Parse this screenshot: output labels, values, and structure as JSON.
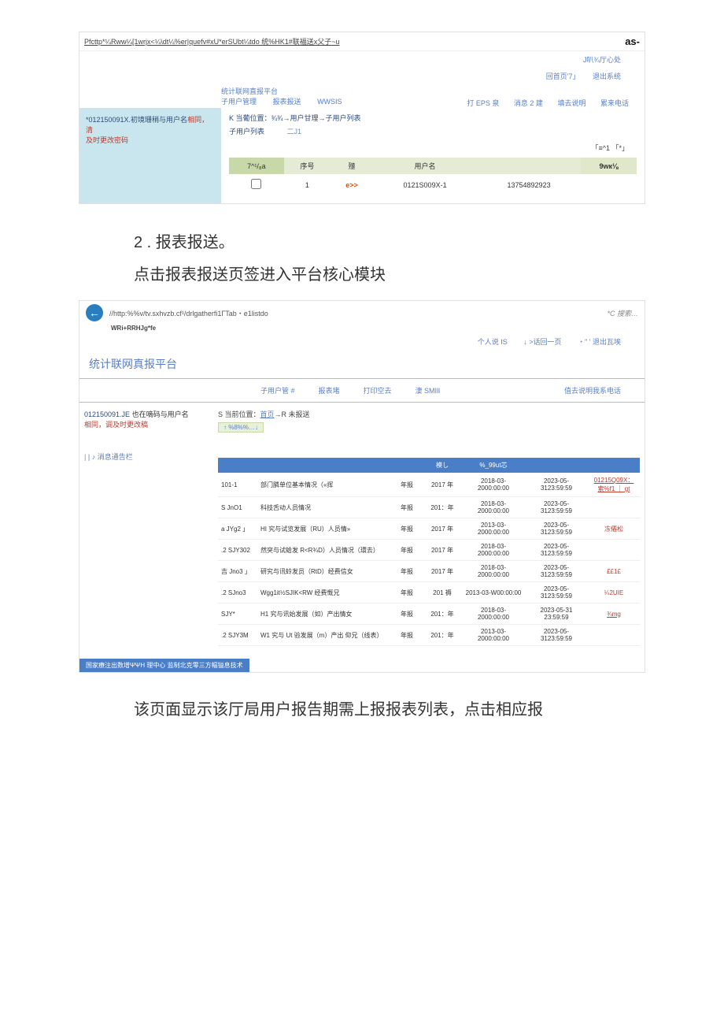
{
  "scr1": {
    "url": "Pfcttp*¼Rww¼[1wrjx<¼\\dt¼%er|quefv#xU*erSUbt¼tdo  统%HK1#联福送x父子~u",
    "as": "as-",
    "topright": {
      "center": "J叭¾厅心处",
      "home": "回首页'7」",
      "exit": "退出系统"
    },
    "nav": {
      "title": "统计联网直报平台",
      "menu1": "子用户管理",
      "menu2": "报表报送",
      "menu3": "WWSIS",
      "menu4": "打 EPS 泉",
      "menu5": "消息 2 建",
      "menu6": "填去说明",
      "menu7": "累来电话"
    },
    "side": {
      "lead": "*012150091X.初境珊稍与用户名",
      "red1": "相同，清",
      "red2": "及时更改密码"
    },
    "loc_prefix": "K 当葡位置：¾¾→用户甘理→子用户列表",
    "loc2": "子用户列表",
    "loc2_sym": "二J1",
    "filter": "「≡^1  「*」",
    "table": {
      "th1": "7^¹/₈a",
      "th2": "序号",
      "th3": "殛",
      "th4": "用户名",
      "th5": "",
      "th6": "9wк⅛",
      "row": {
        "col2": "1",
        "col3": "e>>",
        "col4": "0121S009X-1",
        "col5": "13754892923"
      }
    }
  },
  "para1": "2  . 报表报送。",
  "para2": "点击报表报送页签进入平台核心模块",
  "scr2": {
    "url": "//http:%%v/tv.sxhvzb.cf¹/drlgatherfi1ГTab・e1listdo",
    "search": "*C 搜索…",
    "sub": "WRi+RRHJg*fe",
    "toplinks": {
      "a": "个人说 IS",
      "b": "↓ >话回一页",
      "c": "・\" ' 退出瓦埃"
    },
    "title": "统计联网真报平台",
    "menus": {
      "m1": "子用户管 #",
      "m2": "报表堵",
      "m3": "打印空去",
      "m4": "淒 SMIll",
      "m5": "值去说明我系电话"
    },
    "side": {
      "lead": "012150091.JE",
      "lead2": "也在嘀码与用户名",
      "red1": "相同，调及时更改稿"
    },
    "loc": {
      "pre": "S 当前位置：",
      "home": "首页",
      "rest": "→R 未报送"
    },
    "chip": "↑ %8%%…↓",
    "msgbar": "|  ♪ 消息通告栏",
    "thead": {
      "h1": "",
      "h2": "",
      "h3": "",
      "h4": "模し",
      "h5": "%_99ut芯",
      "h6": "",
      "h7": ""
    },
    "rows": [
      {
        "c1": "101-1",
        "c2": "部门膦单位基本情况（«挥",
        "c3": "年报",
        "c4": "2017 年",
        "c5": "2018-03-2000:00:00",
        "c6": "2023-05-3123:59:59",
        "c7": "01215Q09X：索%f1 ｜ gt",
        "c7red": true,
        "c7ul": true
      },
      {
        "c1": "S JnO1",
        "c2": "科技舌动人员情况",
        "c3": "年报",
        "c4": "201：年",
        "c5": "2018-03-2000:00:00",
        "c6": "2023-05-3123:59:59",
        "c7": ""
      },
      {
        "c1": "a JYg2 」",
        "c2": "HI 究与试览发展（RU）人员情»",
        "c3": "年报",
        "c4": "2017 年",
        "c5": "2013-03-2000:00:00",
        "c6": "2023-05-3123:59:59",
        "c7": "冻僊松",
        "c7red": true
      },
      {
        "c1": ".2  SJY302",
        "c2": "然突与试蛤发 R<R¾D）人员情况（環去）",
        "c3": "年报",
        "c4": "2017 年",
        "c5": "2018-03-2000:00:00",
        "c6": "2023-05-3123:59:59",
        "c7": ""
      },
      {
        "c1": "吉 Jno3 」",
        "c2": "研究与讯蛉发员（RtD）经费信女",
        "c3": "年报",
        "c4": "2017 年",
        "c5": "2018-03-2000:00:00",
        "c6": "2023-05-3123:59:59",
        "c7": "££1£",
        "c7red": true
      },
      {
        "c1": ".2  SJno3",
        "c2": "Wgg1it½SJIK<RW 经费慨兄",
        "c3": "年报",
        "c4": "201 褥",
        "c5": "2013-03-W00:00:00",
        "c6": "2023-05-3123:59:59",
        "c7": "¼2UIE",
        "c7red": true
      },
      {
        "c1": "SJY*",
        "c2": "H1 究与讯始发展（如）产出情女",
        "c3": "年报",
        "c4": "201：年",
        "c5": "2018-03-2000:00:00",
        "c6": "2023-05-31 23:59:59",
        "c7": "¾mg",
        "c7red": true,
        "c7ul": true
      },
      {
        "c1": ".2  SJY3M",
        "c2": "W1 究与 Ut 验发展（m）产出 仰兄（线表）",
        "c3": "年报",
        "c4": "201：年",
        "c5": "2013-03-2000:00:00",
        "c6": "2023-05-3123:59:59",
        "c7": ""
      }
    ],
    "footer": "国家療注出数增ΨΨH 理中心 监制北克零三方幅镒息技术"
  },
  "para_bottom": "该页面显示该厅局用户报告期需上报报表列表，点击相应报"
}
